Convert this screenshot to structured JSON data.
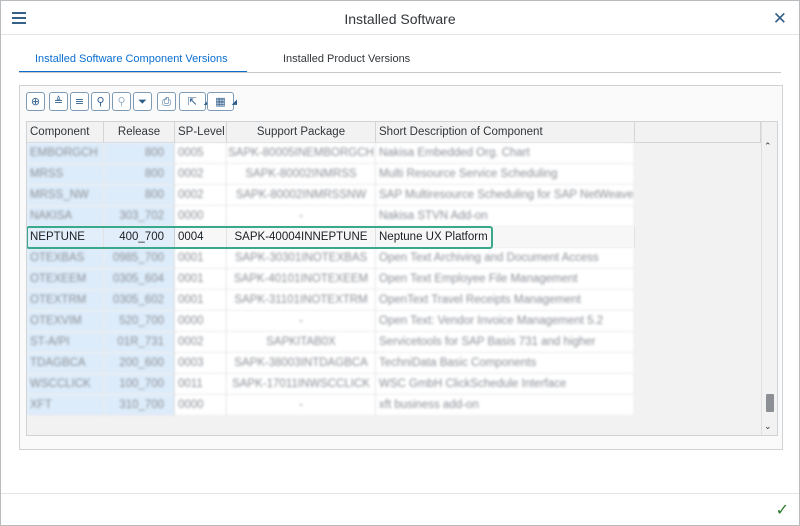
{
  "window": {
    "title": "Installed Software"
  },
  "tabs": [
    {
      "label": "Installed Software Component Versions",
      "active": true
    },
    {
      "label": "Installed Product Versions",
      "active": false
    }
  ],
  "toolbar": {
    "buttons": [
      "zoom-in-icon",
      "sort-ascending-icon",
      "sort-descending-icon",
      "search-icon",
      "search-next-icon",
      "filter-icon",
      "print-icon",
      "export-icon",
      "layout-icon"
    ]
  },
  "grid": {
    "columns": [
      "Component",
      "Release",
      "SP-Level",
      "Support Package",
      "Short Description of Component"
    ],
    "rows": [
      [
        "EMBORGCH",
        "800",
        "0005",
        "SAPK-80005INEMBORGCH",
        "Nakisa Embedded Org. Chart"
      ],
      [
        "MRSS",
        "800",
        "0002",
        "SAPK-80002INMRSS",
        "Multi Resource Service Scheduling"
      ],
      [
        "MRSS_NW",
        "800",
        "0002",
        "SAPK-80002INMRSSNW",
        "SAP Multiresource Scheduling for SAP NetWeaver"
      ],
      [
        "NAKISA",
        "303_702",
        "0000",
        "-",
        "Nakisa STVN Add-on"
      ],
      [
        "NEPTUNE",
        "400_700",
        "0004",
        "SAPK-40004INNEPTUNE",
        "Neptune UX Platform"
      ],
      [
        "OTEXBAS",
        "0985_700",
        "0001",
        "SAPK-30301INOTEXBAS",
        "Open Text Archiving and Document Access"
      ],
      [
        "OTEXEEM",
        "0305_604",
        "0001",
        "SAPK-40101INOTEXEEM",
        "Open Text Employee File Management"
      ],
      [
        "OTEXTRM",
        "0305_602",
        "0001",
        "SAPK-31101INOTEXTRM",
        "OpenText Travel Receipts Management"
      ],
      [
        "OTEXVIM",
        "520_700",
        "0000",
        "-",
        "Open Text: Vendor Invoice Management 5.2"
      ],
      [
        "ST-A/PI",
        "01R_731",
        "0002",
        "SAPKITAB0X",
        "Servicetools for SAP Basis 731 and higher"
      ],
      [
        "TDAGBCA",
        "200_600",
        "0003",
        "SAPK-38003INTDAGBCA",
        "TechniData Basic Components"
      ],
      [
        "WSCCLICK",
        "100_700",
        "0011",
        "SAPK-17011INWSCCLICK",
        "WSC GmbH ClickSchedule Interface"
      ],
      [
        "XFT",
        "310_700",
        "0000",
        "-",
        "xft business add-on"
      ]
    ],
    "highlighted_row": "NEPTUNE"
  }
}
